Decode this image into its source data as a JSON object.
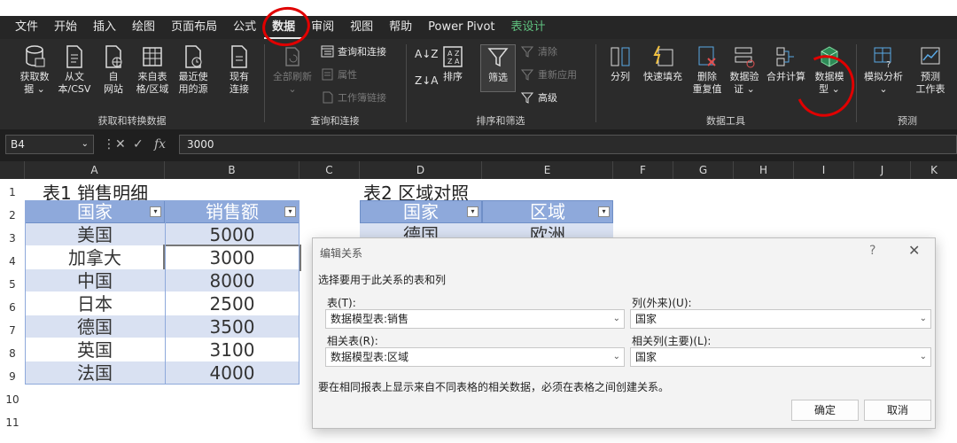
{
  "menu": [
    "文件",
    "开始",
    "插入",
    "绘图",
    "页面布局",
    "公式",
    "数据",
    "审阅",
    "视图",
    "帮助",
    "Power Pivot",
    "表设计"
  ],
  "groups": {
    "get_transform": "获取和转换数据",
    "queries": "查询和连接",
    "sort_filter": "排序和筛选",
    "data_tools": "数据工具",
    "forecast": "预测"
  },
  "buttons": {
    "get_data": [
      "获取数",
      "据 ⌄"
    ],
    "from_text": [
      "从文",
      "本/CSV"
    ],
    "from_web": [
      "自",
      "网站"
    ],
    "from_table": [
      "来自表",
      "格/区域"
    ],
    "recent": [
      "最近使",
      "用的源"
    ],
    "existing": [
      "现有",
      "连接"
    ],
    "refresh_all": [
      "全部刷新",
      ""
    ],
    "queries_connections": "查询和连接",
    "properties": "属性",
    "workbook_links": "工作簿链接",
    "sort": "排序",
    "filter": "筛选",
    "clear": "清除",
    "reapply": "重新应用",
    "advanced": "高级",
    "split": "分列",
    "flash_fill": "快速填充",
    "remove_dup": [
      "删除",
      "重复值"
    ],
    "validation": [
      "数据验",
      "证 ⌄"
    ],
    "consolidate": "合并计算",
    "data_model": [
      "数据模",
      "型 ⌄"
    ],
    "what_if": [
      "模拟分析",
      "⌄"
    ],
    "forecast_sheet": [
      "预测",
      "工作表"
    ]
  },
  "formula_bar": {
    "name_box": "B4",
    "fx": "fx",
    "value": "3000"
  },
  "columns": [
    "A",
    "B",
    "C",
    "D",
    "E",
    "F",
    "G",
    "H",
    "I",
    "J",
    "K"
  ],
  "rows": [
    "1",
    "2",
    "3",
    "4",
    "5",
    "6",
    "7",
    "8",
    "9",
    "10",
    "11"
  ],
  "table1": {
    "title": "表1 销售明细",
    "headers": [
      "国家",
      "销售额"
    ],
    "rows": [
      [
        "美国",
        "5000"
      ],
      [
        "加拿大",
        "3000"
      ],
      [
        "中国",
        "8000"
      ],
      [
        "日本",
        "2500"
      ],
      [
        "德国",
        "3500"
      ],
      [
        "英国",
        "3100"
      ],
      [
        "法国",
        "4000"
      ]
    ]
  },
  "table2": {
    "title": "表2 区域对照",
    "headers": [
      "国家",
      "区域"
    ],
    "rows": [
      [
        "德国",
        "欧洲"
      ]
    ]
  },
  "dialog": {
    "title": "编辑关系",
    "help": "?",
    "close": "✕",
    "subtitle": "选择要用于此关系的表和列",
    "table_label": "表(T):",
    "table_value": "数据模型表:销售",
    "column_label": "列(外来)(U):",
    "column_value": "国家",
    "related_table_label": "相关表(R):",
    "related_table_value": "数据模型表:区域",
    "related_column_label": "相关列(主要)(L):",
    "related_column_value": "国家",
    "note": "要在相同报表上显示来自不同表格的相关数据，必须在表格之间创建关系。",
    "ok": "确定",
    "cancel": "取消"
  },
  "colors": {
    "header_blue": "#8ea9db",
    "band_blue": "#d9e1f2",
    "annotation_red": "#e00000"
  }
}
